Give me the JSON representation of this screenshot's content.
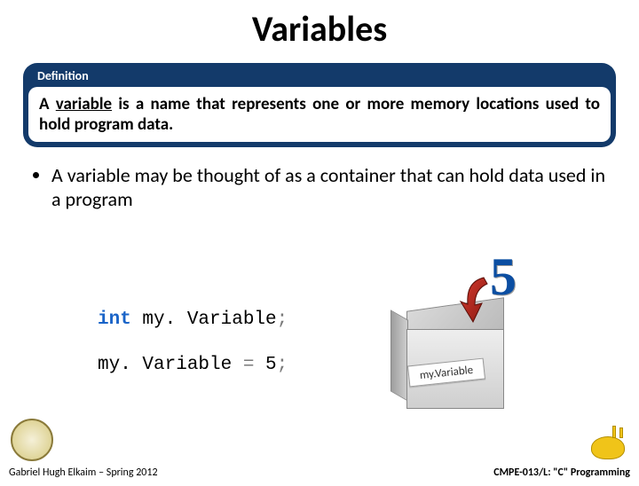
{
  "title": "Variables",
  "definition": {
    "label": "Definition",
    "text_pre": "A ",
    "term": "variable",
    "text_post": " is a name that represents one or more memory locations used to hold program data."
  },
  "bullet1": "A variable may be thought of as a container that can hold data used in a program",
  "code": {
    "kw": "int",
    "decl_name": " my. Variable",
    "semi": ";",
    "assign_left": "my. Variable ",
    "eq": "= ",
    "val": "5",
    "semi2": ";"
  },
  "box": {
    "value": "5",
    "label": "my.Variable"
  },
  "footer": {
    "left": "Gabriel Hugh Elkaim – Spring 2012",
    "right": "CMPE-013/L: \"C\" Programming"
  }
}
